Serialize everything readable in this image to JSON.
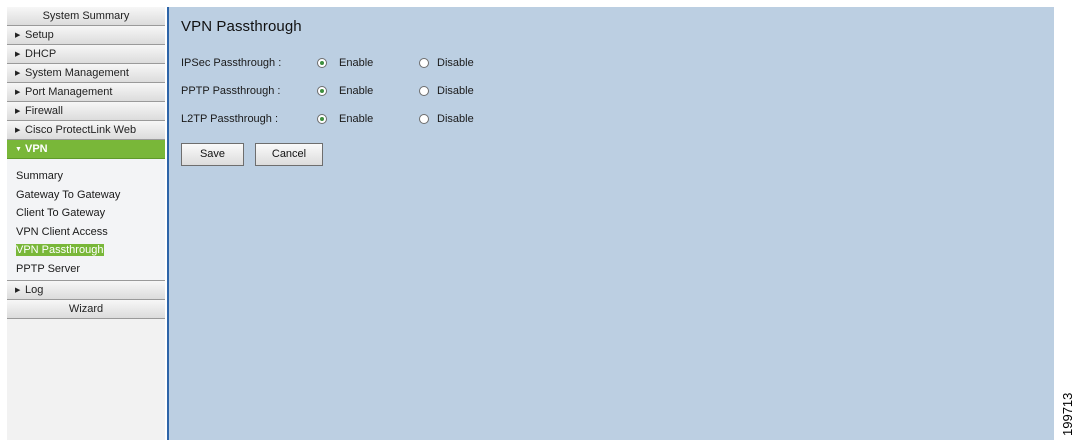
{
  "sidebar": {
    "system_summary": "System Summary",
    "setup": "Setup",
    "dhcp": "DHCP",
    "system_management": "System Management",
    "port_management": "Port Management",
    "firewall": "Firewall",
    "protectlink": "Cisco ProtectLink Web",
    "vpn": "VPN",
    "vpn_items": [
      "Summary",
      "Gateway To Gateway",
      "Client To Gateway",
      "VPN Client Access",
      "VPN Passthrough",
      "PPTP Server"
    ],
    "log": "Log",
    "wizard": "Wizard"
  },
  "main": {
    "title": "VPN Passthrough",
    "rows": [
      {
        "label": "IPSec Passthrough :",
        "enable": "Enable",
        "disable": "Disable",
        "selected": "enable"
      },
      {
        "label": "PPTP Passthrough :",
        "enable": "Enable",
        "disable": "Disable",
        "selected": "enable"
      },
      {
        "label": "L2TP Passthrough :",
        "enable": "Enable",
        "disable": "Disable",
        "selected": "enable"
      }
    ],
    "save_label": "Save",
    "cancel_label": "Cancel"
  },
  "figure_id": "199713",
  "colors": {
    "active_green": "#79b739",
    "content_bg": "#bccfe2",
    "border_blue": "#2d64a8"
  }
}
